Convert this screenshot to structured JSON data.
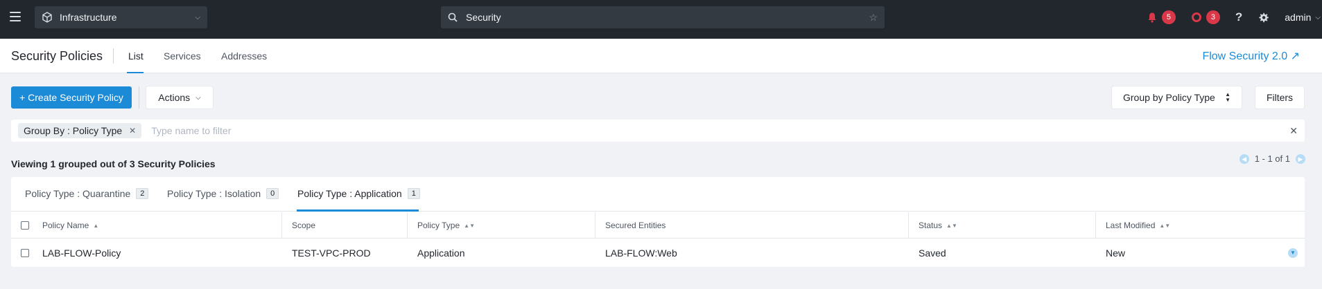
{
  "topbar": {
    "app_switch_label": "Infrastructure",
    "search_value": "Security",
    "alerts_count": "5",
    "events_count": "3",
    "user_label": "admin",
    "alert_color": "#d93849"
  },
  "subheader": {
    "title": "Security Policies",
    "tabs": [
      {
        "label": "List",
        "active": true
      },
      {
        "label": "Services",
        "active": false
      },
      {
        "label": "Addresses",
        "active": false
      }
    ],
    "flow_link": "Flow Security 2.0 ↗"
  },
  "toolbar": {
    "create_label": "+ Create Security Policy",
    "actions_label": "Actions",
    "group_by_label": "Group by Policy Type",
    "filters_label": "Filters"
  },
  "filter": {
    "chip_label": "Group By : Policy Type",
    "placeholder": "Type name to filter"
  },
  "summary": {
    "text": "Viewing 1 grouped out of 3 Security Policies",
    "pager": "1 - 1 of 1"
  },
  "group_tabs": [
    {
      "label": "Policy Type : Quarantine",
      "count": "2",
      "active": false
    },
    {
      "label": "Policy Type : Isolation",
      "count": "0",
      "active": false
    },
    {
      "label": "Policy Type : Application",
      "count": "1",
      "active": true
    }
  ],
  "table": {
    "columns": [
      "Policy Name",
      "Scope",
      "Policy Type",
      "Secured Entities",
      "Status",
      "Last Modified"
    ],
    "rows": [
      {
        "name": "LAB-FLOW-Policy",
        "scope": "TEST-VPC-PROD",
        "type": "Application",
        "entities": "LAB-FLOW:Web",
        "status": "Saved",
        "modified": "New"
      }
    ]
  },
  "accent_color": "#1b8bd8"
}
